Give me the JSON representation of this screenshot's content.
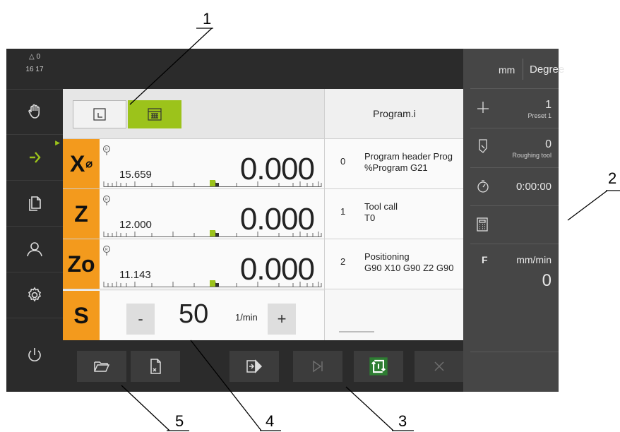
{
  "callouts": [
    "1",
    "2",
    "3",
    "4",
    "5"
  ],
  "status": {
    "warnings": "0",
    "time": "16 17"
  },
  "sidebar": {
    "items": [
      {
        "icon": "hand-icon",
        "label": "Manual operation"
      },
      {
        "icon": "arrow-right-icon",
        "label": "Program run",
        "active": true
      },
      {
        "icon": "files-icon",
        "label": "File management"
      },
      {
        "icon": "user-icon",
        "label": "User login"
      },
      {
        "icon": "gear-icon",
        "label": "Settings"
      },
      {
        "icon": "power-icon",
        "label": "Switch off"
      }
    ]
  },
  "toolbar": {
    "buttons": [
      {
        "icon": "position-view-icon",
        "active": false
      },
      {
        "icon": "program-view-icon",
        "active": true
      }
    ]
  },
  "axes": [
    {
      "name": "X",
      "suffix": "⌀",
      "ref_value": "15.659",
      "position": "0.000"
    },
    {
      "name": "Z",
      "suffix": "",
      "ref_value": "12.000",
      "position": "0.000"
    },
    {
      "name": "Zo",
      "suffix": "",
      "ref_value": "11.143",
      "position": "0.000"
    }
  ],
  "spindle": {
    "name": "S",
    "minus": "-",
    "value": "50",
    "unit": "1/min",
    "plus": "+"
  },
  "program": {
    "title": "Program.i",
    "blocks": [
      {
        "index": "0",
        "line1": "Program header Prog",
        "line2": "%Program G21"
      },
      {
        "index": "1",
        "line1": "Tool call",
        "line2": "T0"
      },
      {
        "index": "2",
        "line1": "Positioning",
        "line2": "G90 X10 G90 Z2 G90"
      }
    ]
  },
  "bottombar": {
    "buttons": [
      {
        "icon": "open-folder-icon"
      },
      {
        "icon": "close-program-icon"
      },
      {
        "icon": "run-block-icon"
      },
      {
        "icon": "next-block-icon"
      },
      {
        "icon": "single-block-icon",
        "active": true
      },
      {
        "icon": "stop-icon"
      }
    ]
  },
  "rightpanel": {
    "unit_length": "mm",
    "unit_angle": "Degree",
    "preset_value": "1",
    "preset_label": "Preset 1",
    "tool_value": "0",
    "tool_label": "Roughing tool",
    "timer": "0:00:00",
    "feed_label": "F",
    "feed_unit": "mm/min",
    "feed_value": "0"
  },
  "colors": {
    "accent_green": "#9cc31b",
    "axis_orange": "#f39a1d",
    "dark": "#2b2b2b"
  }
}
